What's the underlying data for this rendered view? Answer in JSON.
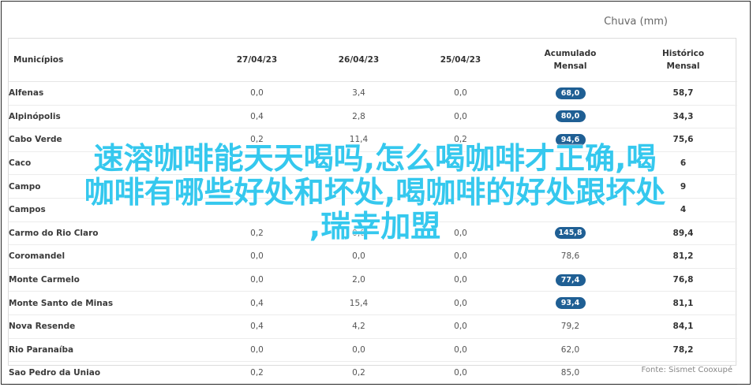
{
  "header": {
    "chuva": "Chuva (mm)"
  },
  "table": {
    "columns": [
      "Municípios",
      "27/04/23",
      "26/04/23",
      "25/04/23",
      "Acumulado Mensal",
      "Histórico Mensal"
    ],
    "header_lines": [
      [
        "Municípios"
      ],
      [
        "27/04/23"
      ],
      [
        "26/04/23"
      ],
      [
        "25/04/23"
      ],
      [
        "Acumulado",
        "Mensal"
      ],
      [
        "Histórico",
        "Mensal"
      ]
    ],
    "rows": [
      {
        "municipio": "Alfenas",
        "d27": "0,0",
        "d26": "3,4",
        "d25": "0,0",
        "acumulado": "68,0",
        "highlight": true,
        "historico": "58,7"
      },
      {
        "municipio": "Alpinópolis",
        "d27": "0,4",
        "d26": "2,8",
        "d25": "0,0",
        "acumulado": "80,0",
        "highlight": true,
        "historico": "34,3"
      },
      {
        "municipio": "Cabo Verde",
        "d27": "0,2",
        "d26": "11,4",
        "d25": "0,2",
        "acumulado": "94,6",
        "highlight": true,
        "historico": "75,6"
      },
      {
        "municipio": "Caco",
        "d27": "",
        "d26": "",
        "d25": "",
        "acumulado": "",
        "highlight": false,
        "historico": "6"
      },
      {
        "municipio": "Campo",
        "d27": "",
        "d26": "",
        "d25": "",
        "acumulado": "",
        "highlight": false,
        "historico": "9"
      },
      {
        "municipio": "Campos",
        "d27": "",
        "d26": "",
        "d25": "",
        "acumulado": "",
        "highlight": false,
        "historico": "4"
      },
      {
        "municipio": "Carmo do Rio Claro",
        "d27": "0,2",
        "d26": "0,0",
        "d25": "0,0",
        "acumulado": "145,8",
        "highlight": true,
        "historico": "89,4"
      },
      {
        "municipio": "Coromandel",
        "d27": "0,0",
        "d26": "0,0",
        "d25": "0,0",
        "acumulado": "78,6",
        "highlight": false,
        "historico": "81,2"
      },
      {
        "municipio": "Monte Carmelo",
        "d27": "0,0",
        "d26": "2,0",
        "d25": "0,0",
        "acumulado": "77,4",
        "highlight": true,
        "historico": "76,8"
      },
      {
        "municipio": "Monte Santo de Minas",
        "d27": "0,4",
        "d26": "15,4",
        "d25": "0,0",
        "acumulado": "93,4",
        "highlight": true,
        "historico": "81,1"
      },
      {
        "municipio": "Nova Resende",
        "d27": "0,4",
        "d26": "4,2",
        "d25": "0,0",
        "acumulado": "79,2",
        "highlight": false,
        "historico": "84,1"
      },
      {
        "municipio": "Rio Paranaíba",
        "d27": "0,0",
        "d26": "0,0",
        "d25": "0,0",
        "acumulado": "62,0",
        "highlight": false,
        "historico": "78,2"
      },
      {
        "municipio": "Sao Pedro da Uniao",
        "d27": "0,2",
        "d26": "0,2",
        "d25": "0,0",
        "acumulado": "85,0",
        "highlight": false,
        "historico": ""
      }
    ]
  },
  "footer": {
    "fonte": "Fonte: Sismet Cooxupé"
  },
  "overlay": {
    "lines": [
      "速溶咖啡能天天喝吗,怎么喝咖啡才正确,喝",
      "咖啡有哪些好处和坏处,喝咖啡的好处跟坏处",
      ",瑞幸加盟"
    ],
    "color": "#35c8ee"
  },
  "colors": {
    "pill": "#1f5f94",
    "border": "#2b2b2b"
  }
}
